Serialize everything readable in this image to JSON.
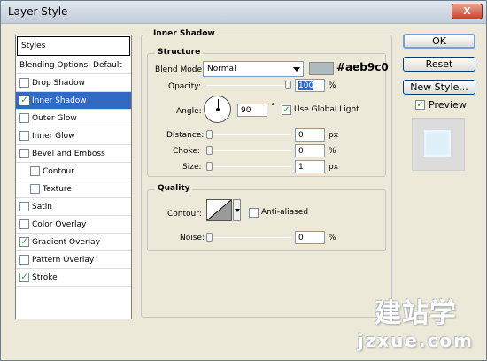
{
  "window": {
    "title": "Layer Style",
    "close_glyph": "X"
  },
  "styles_panel": {
    "header": "Styles",
    "items": [
      {
        "label": "Blending Options: Default",
        "checked": null,
        "selected": false,
        "indent": 0
      },
      {
        "label": "Drop Shadow",
        "checked": false,
        "selected": false,
        "indent": 0
      },
      {
        "label": "Inner Shadow",
        "checked": true,
        "selected": true,
        "indent": 0
      },
      {
        "label": "Outer Glow",
        "checked": false,
        "selected": false,
        "indent": 0
      },
      {
        "label": "Inner Glow",
        "checked": false,
        "selected": false,
        "indent": 0
      },
      {
        "label": "Bevel and Emboss",
        "checked": false,
        "selected": false,
        "indent": 0
      },
      {
        "label": "Contour",
        "checked": false,
        "selected": false,
        "indent": 1
      },
      {
        "label": "Texture",
        "checked": false,
        "selected": false,
        "indent": 1
      },
      {
        "label": "Satin",
        "checked": false,
        "selected": false,
        "indent": 0
      },
      {
        "label": "Color Overlay",
        "checked": false,
        "selected": false,
        "indent": 0
      },
      {
        "label": "Gradient Overlay",
        "checked": true,
        "selected": false,
        "indent": 0
      },
      {
        "label": "Pattern Overlay",
        "checked": false,
        "selected": false,
        "indent": 0
      },
      {
        "label": "Stroke",
        "checked": true,
        "selected": false,
        "indent": 0
      }
    ]
  },
  "inner_shadow": {
    "title": "Inner Shadow",
    "structure": {
      "title": "Structure",
      "blend_mode_label": "Blend Mode:",
      "blend_mode_value": "Normal",
      "color_hex_label": "#aeb9c0",
      "swatch_color": "#aeb9c0",
      "opacity_label": "Opacity:",
      "opacity_value": "100",
      "opacity_level": 1.0,
      "percent": "%",
      "angle_label": "Angle:",
      "angle_value": "90",
      "degree": "°",
      "use_global_light_label": "Use Global Light",
      "use_global_light_checked": true,
      "distance_label": "Distance:",
      "distance_value": "0",
      "choke_label": "Choke:",
      "choke_value": "0",
      "size_label": "Size:",
      "size_value": "1",
      "px": "px"
    },
    "quality": {
      "title": "Quality",
      "contour_label": "Contour:",
      "anti_aliased_label": "Anti-aliased",
      "anti_aliased_checked": false,
      "noise_label": "Noise:",
      "noise_value": "0",
      "percent": "%"
    }
  },
  "buttons": {
    "ok": "OK",
    "reset": "Reset",
    "new_style": "New Style...",
    "preview_label": "Preview",
    "preview_checked": true
  },
  "watermark": {
    "big": "建站学",
    "small": "jzxue.com"
  },
  "colors": {
    "selection": "#316ac5",
    "check": "#21a121"
  }
}
